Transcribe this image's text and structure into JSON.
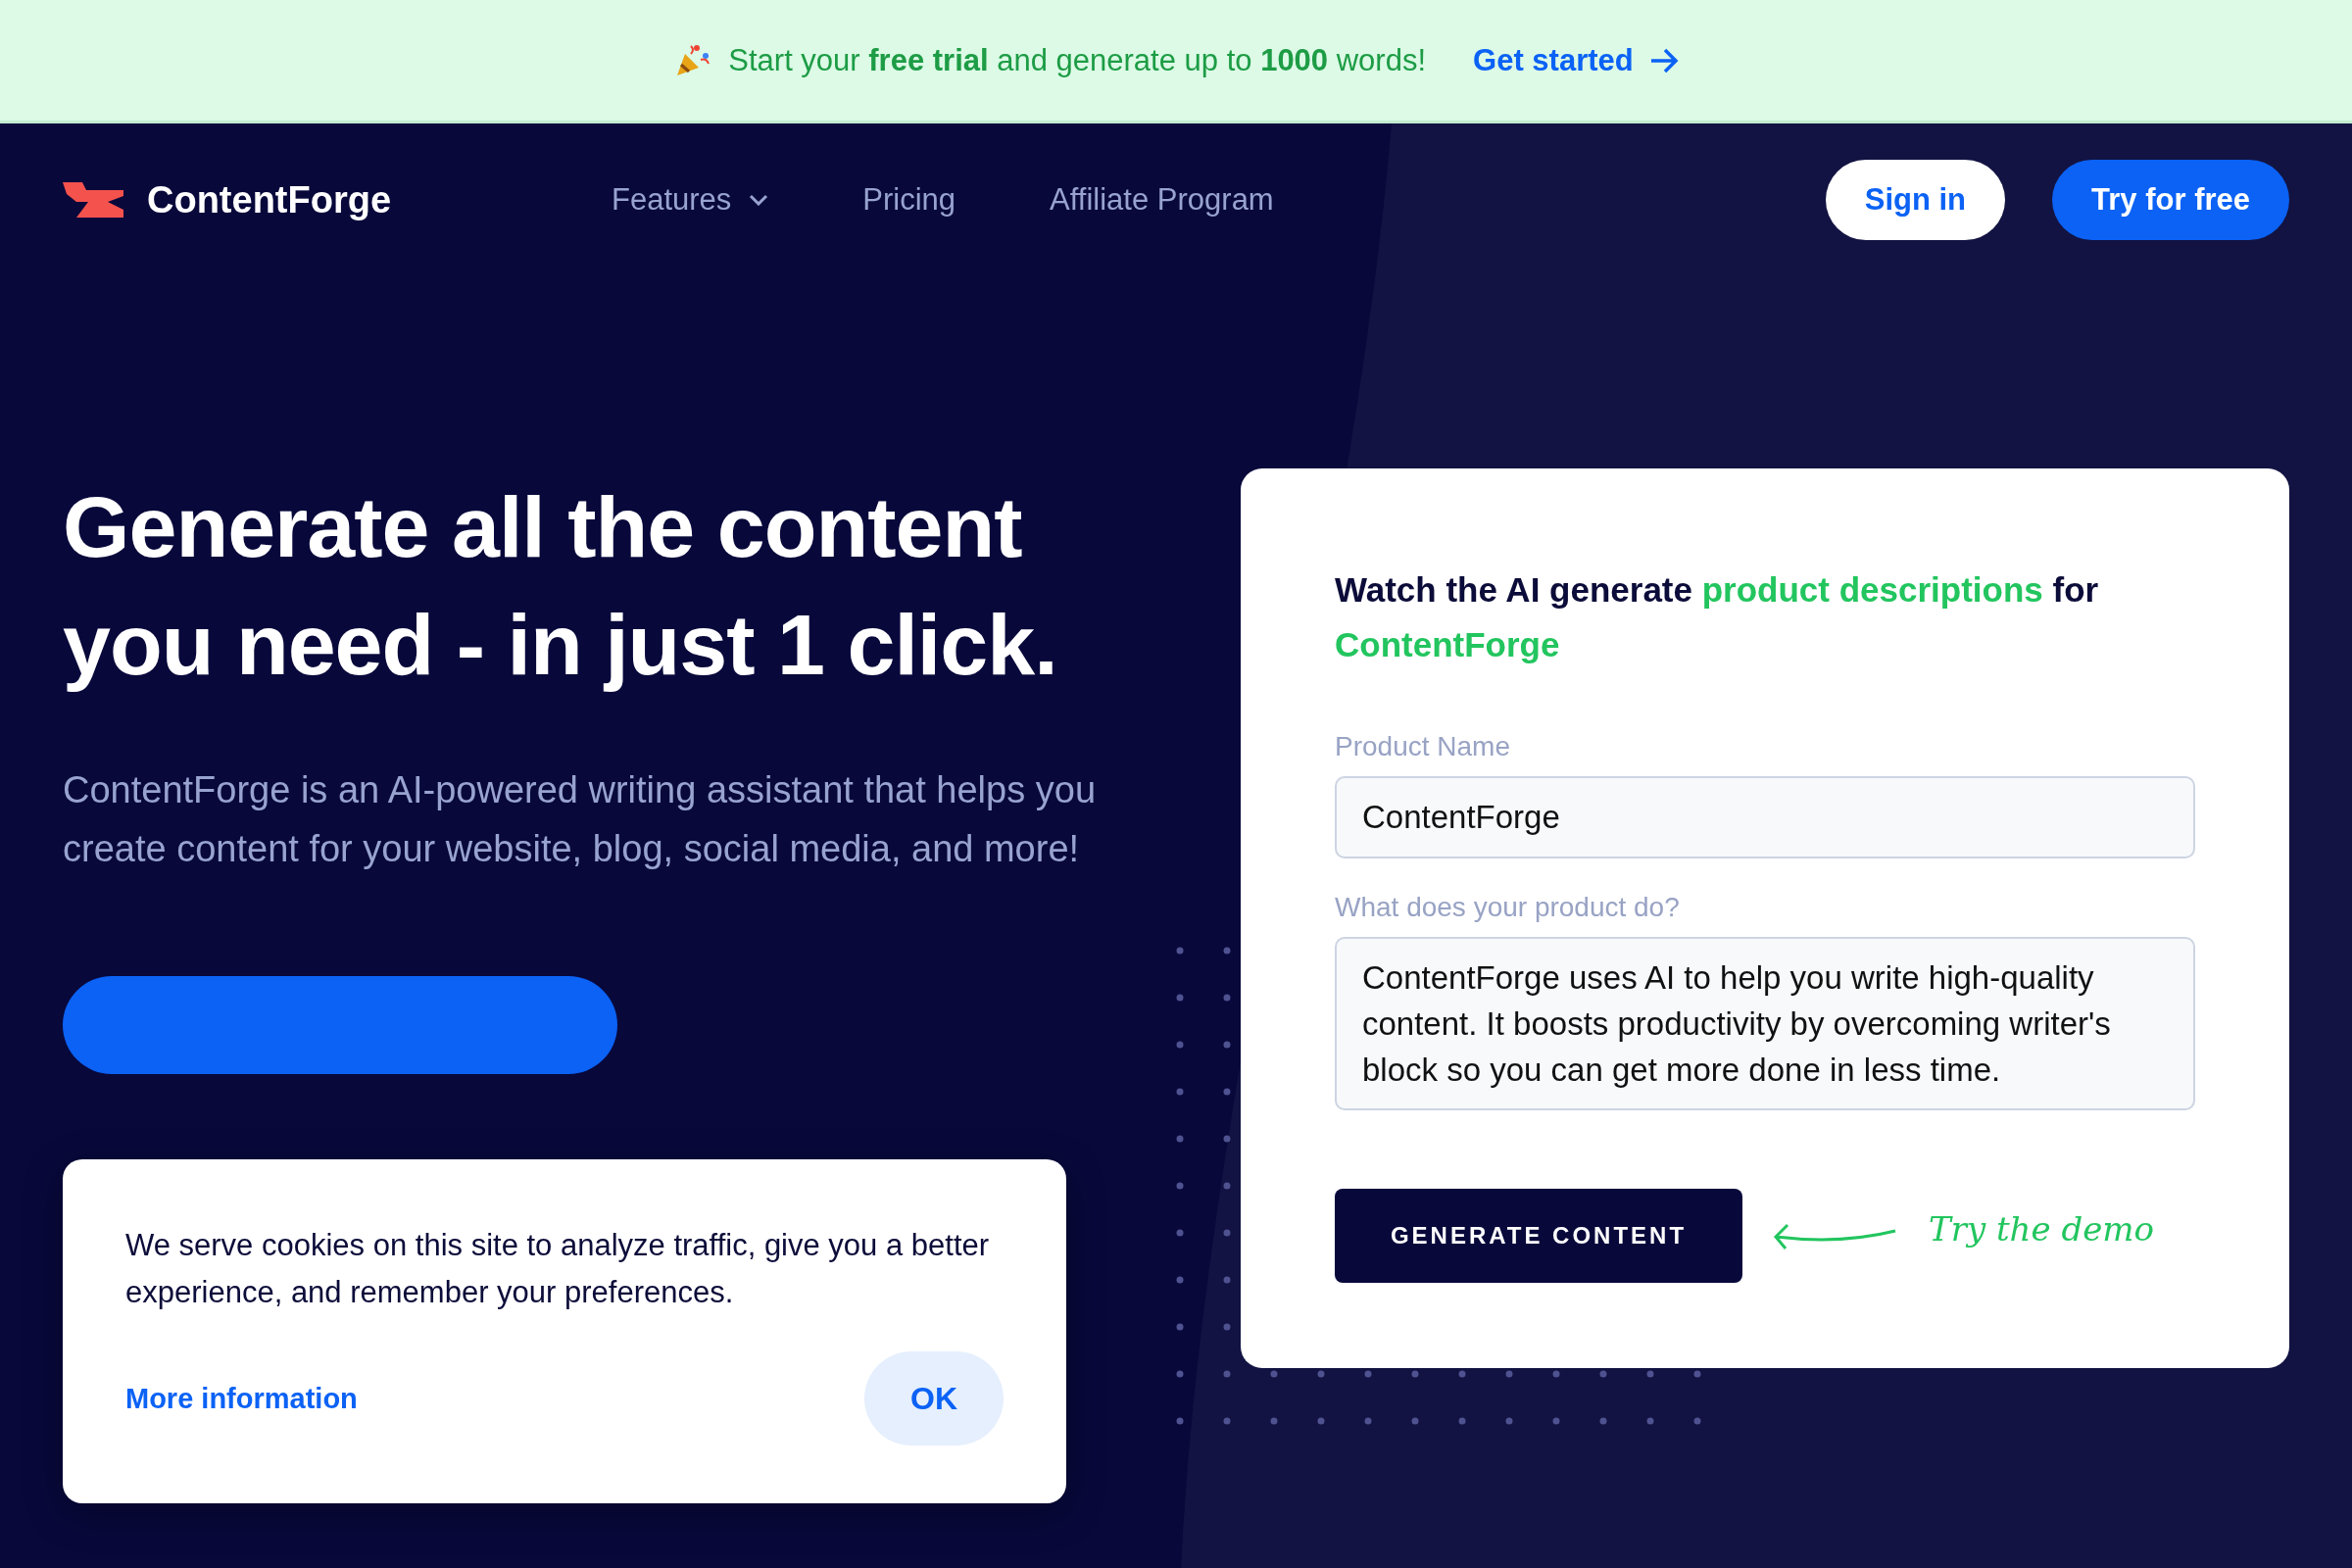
{
  "banner": {
    "text": "Start your **free trial** and generate up to **1000** words!",
    "link": "Get started"
  },
  "nav": {
    "brand": "ContentForge",
    "items": [
      {
        "label": "Features",
        "dropdown": true
      },
      {
        "label": "Pricing",
        "dropdown": false
      },
      {
        "label": "Affiliate Program",
        "dropdown": false
      }
    ],
    "sign_in": "Sign in",
    "try_free": "Try for free"
  },
  "hero": {
    "heading": "Generate all the content you need - in just 1 click.",
    "text": "ContentForge is an AI-powered writing assistant that helps you create content for your website, blog, social media, and more!"
  },
  "demo": {
    "heading": [
      {
        "text": "Watch the AI generate ",
        "highlight": false
      },
      {
        "text": "product descriptions",
        "highlight": true
      },
      {
        "text": " for ",
        "highlight": false
      },
      {
        "text": "ContentForge",
        "highlight": true
      }
    ],
    "fields": [
      {
        "kind": "input",
        "label": "Product Name",
        "value": "ContentForge"
      },
      {
        "kind": "textarea",
        "label": "What does your product do?",
        "value": "ContentForge uses AI to help you write high-quality content. It boosts productivity by overcoming writer's block so you can get more done in less time."
      }
    ],
    "button": "GENERATE CONTENT",
    "hint": "Try the demo"
  },
  "cookie": {
    "text": "We serve cookies on this site to analyze traffic, give you a better experience, and remember your preferences.",
    "link": "More information",
    "ok": "OK"
  }
}
